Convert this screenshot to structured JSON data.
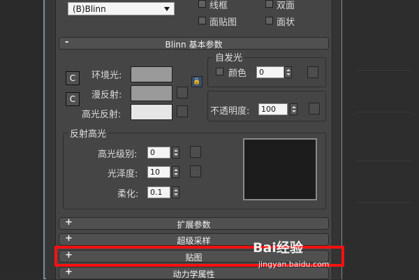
{
  "shader": {
    "selected": "(B)Blinn"
  },
  "shader_options": [
    {
      "label": "线框",
      "checked": false
    },
    {
      "label": "双面",
      "checked": false
    },
    {
      "label": "面贴图",
      "checked": false
    },
    {
      "label": "面状",
      "checked": false
    }
  ],
  "blinn_panel": {
    "collapse_sign": "-",
    "title": "Blinn 基本参数",
    "ambient_label": "环境光:",
    "diffuse_label": "漫反射:",
    "specular_label": "高光反射:",
    "lock_symbol": "🔒",
    "c_button": "C",
    "ambient_color": "#9a9a9a",
    "diffuse_color": "#9a9a9a",
    "specular_color": "#e6e6e6"
  },
  "self_illum": {
    "title": "自发光",
    "color_label": "颜色",
    "value": "0"
  },
  "opacity": {
    "label": "不透明度:",
    "value": "100"
  },
  "specular_highlights": {
    "title": "反射高光",
    "level_label": "高光级别:",
    "level_value": "0",
    "gloss_label": "光泽度:",
    "gloss_value": "10",
    "soften_label": "柔化:",
    "soften_value": "0.1"
  },
  "rollouts": [
    {
      "sign": "+",
      "title": "扩展参数"
    },
    {
      "sign": "+",
      "title": "超级采样"
    },
    {
      "sign": "+",
      "title": "贴图"
    },
    {
      "sign": "+",
      "title": "动力学属性"
    }
  ],
  "watermark": {
    "text": "Bai经验",
    "url": "jingyan.baidu.com"
  },
  "colors": {
    "highlight": "#ff1010",
    "panel_bg": "#454545",
    "rollout_bg": "#505050"
  }
}
